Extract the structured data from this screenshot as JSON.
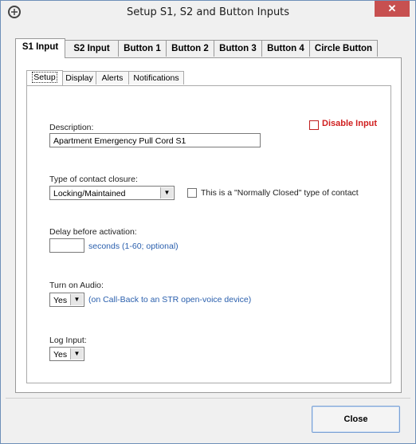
{
  "window": {
    "title": "Setup S1, S2 and Button Inputs",
    "close_glyph": "✕"
  },
  "outer_tabs": [
    "S1 Input",
    "S2 Input",
    "Button 1",
    "Button 2",
    "Button 3",
    "Button 4",
    "Circle Button"
  ],
  "inner_tabs": [
    "Setup",
    "Display",
    "Alerts",
    "Notifications"
  ],
  "form": {
    "disable_input_label": "Disable Input",
    "description_label": "Description:",
    "description_value": "Apartment Emergency Pull Cord S1",
    "contact_type_label": "Type of contact closure:",
    "contact_type_value": "Locking/Maintained",
    "normally_closed_label": "This is a \"Normally Closed\" type of contact",
    "delay_label": "Delay before activation:",
    "delay_value": "",
    "delay_hint": "seconds (1-60; optional)",
    "audio_label": "Turn on Audio:",
    "audio_value": "Yes",
    "audio_hint": "(on Call-Back to an STR open-voice device)",
    "log_label": "Log Input:",
    "log_value": "Yes"
  },
  "buttons": {
    "close": "Close"
  },
  "colors": {
    "accent_red": "#d01f1f",
    "hint_blue": "#2a5fad",
    "title_close_bg": "#c75050"
  },
  "icons": {
    "app": "app-logo-icon",
    "dropdown": "chevron-down-icon"
  }
}
